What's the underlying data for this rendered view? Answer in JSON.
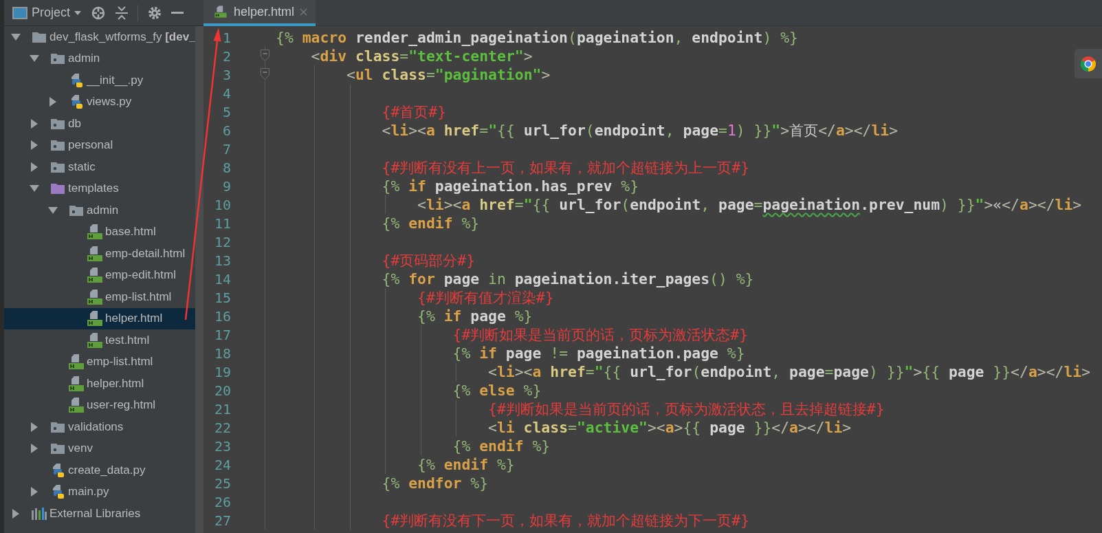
{
  "project_panel": {
    "title": "Project",
    "tree": [
      {
        "kind": "folder",
        "label": "dev_flask_wtforms_fy **[dev_**",
        "expanded": true,
        "selected": false,
        "children": [
          {
            "kind": "package",
            "label": "admin",
            "expanded": true,
            "selected": false,
            "children": [
              {
                "kind": "python-file",
                "label": "__init__.py",
                "selected": false
              },
              {
                "kind": "python-file",
                "label": "views.py",
                "expanded": false,
                "selected": false
              }
            ]
          },
          {
            "kind": "package",
            "label": "db",
            "expanded": false,
            "selected": false
          },
          {
            "kind": "package",
            "label": "personal",
            "expanded": false,
            "selected": false
          },
          {
            "kind": "package",
            "label": "static",
            "expanded": false,
            "selected": false
          },
          {
            "kind": "template-folder",
            "label": "templates",
            "expanded": true,
            "selected": false,
            "children": [
              {
                "kind": "package",
                "label": "admin",
                "expanded": true,
                "selected": false,
                "children": [
                  {
                    "kind": "html-file",
                    "label": "base.html",
                    "selected": false
                  },
                  {
                    "kind": "html-file",
                    "label": "emp-detail.html",
                    "selected": false
                  },
                  {
                    "kind": "html-file",
                    "label": "emp-edit.html",
                    "selected": false
                  },
                  {
                    "kind": "html-file",
                    "label": "emp-list.html",
                    "selected": false
                  },
                  {
                    "kind": "html-file",
                    "label": "helper.html",
                    "selected": true
                  },
                  {
                    "kind": "html-file",
                    "label": "test.html",
                    "selected": false
                  }
                ]
              },
              {
                "kind": "html-file",
                "label": "emp-list.html",
                "selected": false
              },
              {
                "kind": "html-file",
                "label": "helper.html",
                "selected": false
              },
              {
                "kind": "html-file",
                "label": "user-reg.html",
                "selected": false
              }
            ]
          },
          {
            "kind": "package",
            "label": "validations",
            "expanded": false,
            "selected": false
          },
          {
            "kind": "package",
            "label": "venv",
            "expanded": false,
            "selected": false
          },
          {
            "kind": "python-file",
            "label": "create_data.py",
            "selected": false
          },
          {
            "kind": "python-file",
            "label": "main.py",
            "expanded": false,
            "selected": false
          }
        ]
      },
      {
        "kind": "library",
        "label": "External Libraries",
        "expanded": false,
        "selected": false
      }
    ]
  },
  "editor": {
    "tabs": [
      {
        "label": "helper.html",
        "selected": true
      }
    ],
    "lines": [
      {
        "number": "1",
        "fold": false,
        "tokens": [
          {
            "kind": "delim",
            "text": "{%"
          },
          {
            "kind": "keyword",
            "text": " macro"
          },
          {
            "kind": "ident",
            "text": " render_admin_pageination"
          },
          {
            "kind": "delim",
            "text": "("
          },
          {
            "kind": "ident",
            "text": "pageination"
          },
          {
            "kind": "delim",
            "text": ","
          },
          {
            "kind": "ident",
            "text": " endpoint"
          },
          {
            "kind": "delim",
            "text": ")"
          },
          {
            "kind": "delim",
            "text": " %}"
          }
        ]
      },
      {
        "number": "2",
        "fold": true,
        "tokens": [
          {
            "kind": "punct",
            "text": "    <"
          },
          {
            "kind": "tag",
            "text": "div"
          },
          {
            "kind": "attr",
            "text": " class"
          },
          {
            "kind": "delim",
            "text": "="
          },
          {
            "kind": "string",
            "text": "\"text-center\""
          },
          {
            "kind": "punct",
            "text": ">"
          }
        ]
      },
      {
        "number": "3",
        "fold": true,
        "tokens": [
          {
            "kind": "punct",
            "text": "        <"
          },
          {
            "kind": "tag",
            "text": "ul"
          },
          {
            "kind": "attr",
            "text": " class"
          },
          {
            "kind": "delim",
            "text": "="
          },
          {
            "kind": "string",
            "text": "\"pagination\""
          },
          {
            "kind": "punct",
            "text": ">"
          }
        ]
      },
      {
        "number": "4",
        "fold": false
      },
      {
        "number": "5",
        "fold": false,
        "tokens": [
          {
            "kind": "comment",
            "text": "            {#首页#}"
          }
        ]
      },
      {
        "number": "6",
        "fold": false,
        "tokens": [
          {
            "kind": "punct",
            "text": "            <"
          },
          {
            "kind": "tag",
            "text": "li"
          },
          {
            "kind": "punct",
            "text": "><"
          },
          {
            "kind": "tag",
            "text": "a"
          },
          {
            "kind": "attr",
            "text": " href"
          },
          {
            "kind": "delim",
            "text": "="
          },
          {
            "kind": "string",
            "text": "\""
          },
          {
            "kind": "delim",
            "text": "{{"
          },
          {
            "kind": "ident",
            "text": " url_for"
          },
          {
            "kind": "delim",
            "text": "("
          },
          {
            "kind": "ident",
            "text": "endpoint"
          },
          {
            "kind": "delim",
            "text": ","
          },
          {
            "kind": "ident",
            "text": " page"
          },
          {
            "kind": "delim",
            "text": "="
          },
          {
            "kind": "number",
            "text": "1"
          },
          {
            "kind": "delim",
            "text": ") }}"
          },
          {
            "kind": "string",
            "text": "\""
          },
          {
            "kind": "punct",
            "text": ">"
          },
          {
            "kind": "text",
            "text": "首页"
          },
          {
            "kind": "punct",
            "text": "</"
          },
          {
            "kind": "tag",
            "text": "a"
          },
          {
            "kind": "punct",
            "text": "></"
          },
          {
            "kind": "tag",
            "text": "li"
          },
          {
            "kind": "punct",
            "text": ">"
          }
        ]
      },
      {
        "number": "7",
        "fold": false
      },
      {
        "number": "8",
        "fold": false,
        "tokens": [
          {
            "kind": "comment",
            "text": "            {#判断有没有上一页，如果有，就加个超链接为上一页#}"
          }
        ]
      },
      {
        "number": "9",
        "fold": false,
        "tokens": [
          {
            "kind": "delim",
            "text": "            {%"
          },
          {
            "kind": "keyword",
            "text": " if"
          },
          {
            "kind": "ident",
            "text": " pageination.has_prev"
          },
          {
            "kind": "delim",
            "text": " %}"
          }
        ]
      },
      {
        "number": "10",
        "fold": false,
        "tokens": [
          {
            "kind": "punct",
            "text": "                <"
          },
          {
            "kind": "tag",
            "text": "li"
          },
          {
            "kind": "punct",
            "text": "><"
          },
          {
            "kind": "tag",
            "text": "a"
          },
          {
            "kind": "attr",
            "text": " href"
          },
          {
            "kind": "delim",
            "text": "="
          },
          {
            "kind": "string",
            "text": "\""
          },
          {
            "kind": "delim",
            "text": "{{"
          },
          {
            "kind": "ident",
            "text": " url_for"
          },
          {
            "kind": "delim",
            "text": "("
          },
          {
            "kind": "ident",
            "text": "endpoint"
          },
          {
            "kind": "delim",
            "text": ","
          },
          {
            "kind": "ident",
            "text": " page"
          },
          {
            "kind": "delim",
            "text": "="
          },
          {
            "kind": "typo",
            "text": "pageination"
          },
          {
            "kind": "ident",
            "text": ".prev_num"
          },
          {
            "kind": "delim",
            "text": ") }}"
          },
          {
            "kind": "string",
            "text": "\""
          },
          {
            "kind": "punct",
            "text": ">"
          },
          {
            "kind": "text",
            "text": "«"
          },
          {
            "kind": "punct",
            "text": "</"
          },
          {
            "kind": "tag",
            "text": "a"
          },
          {
            "kind": "punct",
            "text": "></"
          },
          {
            "kind": "tag",
            "text": "li"
          },
          {
            "kind": "punct",
            "text": ">"
          }
        ]
      },
      {
        "number": "11",
        "fold": false,
        "tokens": [
          {
            "kind": "delim",
            "text": "            {%"
          },
          {
            "kind": "keyword",
            "text": " endif"
          },
          {
            "kind": "delim",
            "text": " %}"
          }
        ]
      },
      {
        "number": "12",
        "fold": false
      },
      {
        "number": "13",
        "fold": false,
        "tokens": [
          {
            "kind": "comment",
            "text": "            {#页码部分#}"
          }
        ]
      },
      {
        "number": "14",
        "fold": false,
        "tokens": [
          {
            "kind": "delim",
            "text": "            {%"
          },
          {
            "kind": "keyword",
            "text": " for"
          },
          {
            "kind": "ident",
            "text": " page"
          },
          {
            "kind": "delim",
            "text": " in"
          },
          {
            "kind": "ident",
            "text": " pageination.iter_pages"
          },
          {
            "kind": "delim",
            "text": "() %}"
          }
        ]
      },
      {
        "number": "15",
        "fold": false,
        "tokens": [
          {
            "kind": "comment",
            "text": "                {#判断有值才渲染#}"
          }
        ]
      },
      {
        "number": "16",
        "fold": false,
        "tokens": [
          {
            "kind": "delim",
            "text": "                {%"
          },
          {
            "kind": "keyword",
            "text": " if"
          },
          {
            "kind": "ident",
            "text": " page"
          },
          {
            "kind": "delim",
            "text": " %}"
          }
        ]
      },
      {
        "number": "17",
        "fold": false,
        "tokens": [
          {
            "kind": "comment",
            "text": "                    {#判断如果是当前页的话，页标为激活状态#}"
          }
        ]
      },
      {
        "number": "18",
        "fold": false,
        "tokens": [
          {
            "kind": "delim",
            "text": "                    {%"
          },
          {
            "kind": "keyword",
            "text": " if"
          },
          {
            "kind": "ident",
            "text": " page"
          },
          {
            "kind": "delim",
            "text": " !="
          },
          {
            "kind": "ident",
            "text": " pageination.page"
          },
          {
            "kind": "delim",
            "text": " %}"
          }
        ]
      },
      {
        "number": "19",
        "fold": false,
        "tokens": [
          {
            "kind": "punct",
            "text": "                        <"
          },
          {
            "kind": "tag",
            "text": "li"
          },
          {
            "kind": "punct",
            "text": "><"
          },
          {
            "kind": "tag",
            "text": "a"
          },
          {
            "kind": "attr",
            "text": " href"
          },
          {
            "kind": "delim",
            "text": "="
          },
          {
            "kind": "string",
            "text": "\""
          },
          {
            "kind": "delim",
            "text": "{{"
          },
          {
            "kind": "ident",
            "text": " url_for"
          },
          {
            "kind": "delim",
            "text": "("
          },
          {
            "kind": "ident",
            "text": "endpoint"
          },
          {
            "kind": "delim",
            "text": ","
          },
          {
            "kind": "ident",
            "text": " page"
          },
          {
            "kind": "delim",
            "text": "="
          },
          {
            "kind": "ident",
            "text": "page"
          },
          {
            "kind": "delim",
            "text": ") }}"
          },
          {
            "kind": "string",
            "text": "\""
          },
          {
            "kind": "punct",
            "text": ">"
          },
          {
            "kind": "delim",
            "text": "{{"
          },
          {
            "kind": "ident",
            "text": " page"
          },
          {
            "kind": "delim",
            "text": " }}"
          },
          {
            "kind": "punct",
            "text": "</"
          },
          {
            "kind": "tag",
            "text": "a"
          },
          {
            "kind": "punct",
            "text": "></"
          },
          {
            "kind": "tag",
            "text": "li"
          },
          {
            "kind": "punct",
            "text": ">"
          }
        ]
      },
      {
        "number": "20",
        "fold": false,
        "tokens": [
          {
            "kind": "delim",
            "text": "                    {%"
          },
          {
            "kind": "keyword",
            "text": " else"
          },
          {
            "kind": "delim",
            "text": " %}"
          }
        ]
      },
      {
        "number": "21",
        "fold": false,
        "tokens": [
          {
            "kind": "comment",
            "text": "                        {#判断如果是当前页的话，页标为激活状态，且去掉超链接#}"
          }
        ]
      },
      {
        "number": "22",
        "fold": false,
        "tokens": [
          {
            "kind": "punct",
            "text": "                        <"
          },
          {
            "kind": "tag",
            "text": "li"
          },
          {
            "kind": "attr",
            "text": " class"
          },
          {
            "kind": "delim",
            "text": "="
          },
          {
            "kind": "string",
            "text": "\"active\""
          },
          {
            "kind": "punct",
            "text": "><"
          },
          {
            "kind": "tag",
            "text": "a"
          },
          {
            "kind": "punct",
            "text": ">"
          },
          {
            "kind": "delim",
            "text": "{{"
          },
          {
            "kind": "ident",
            "text": " page"
          },
          {
            "kind": "delim",
            "text": " }}"
          },
          {
            "kind": "punct",
            "text": "</"
          },
          {
            "kind": "tag",
            "text": "a"
          },
          {
            "kind": "punct",
            "text": "></"
          },
          {
            "kind": "tag",
            "text": "li"
          },
          {
            "kind": "punct",
            "text": ">"
          }
        ]
      },
      {
        "number": "23",
        "fold": false,
        "tokens": [
          {
            "kind": "delim",
            "text": "                    {%"
          },
          {
            "kind": "keyword",
            "text": " endif"
          },
          {
            "kind": "delim",
            "text": " %}"
          }
        ]
      },
      {
        "number": "24",
        "fold": false,
        "tokens": [
          {
            "kind": "delim",
            "text": "                {%"
          },
          {
            "kind": "keyword",
            "text": " endif"
          },
          {
            "kind": "delim",
            "text": " %}"
          }
        ]
      },
      {
        "number": "25",
        "fold": false,
        "tokens": [
          {
            "kind": "delim",
            "text": "            {%"
          },
          {
            "kind": "keyword",
            "text": " endfor"
          },
          {
            "kind": "delim",
            "text": " %}"
          }
        ]
      },
      {
        "number": "26",
        "fold": false
      },
      {
        "number": "27",
        "fold": false,
        "tokens": [
          {
            "kind": "comment",
            "text": "            {#判断有没有下一页，如果有，就加个超链接为下一页#}"
          }
        ]
      }
    ]
  }
}
